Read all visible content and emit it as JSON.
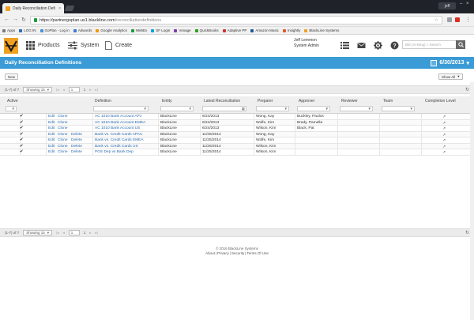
{
  "browser": {
    "tab_title": "Daily Reconciliation Defi",
    "tab_close": "×",
    "profile": "jeff",
    "url_host": "https://partnergoplan.us1.blackline.com",
    "url_path": "/reconciliationdefinitions",
    "bookmarks": [
      {
        "label": "Apps",
        "color": "#7a7a7a"
      },
      {
        "label": "LOG IN",
        "color": "#2b6cb0"
      },
      {
        "label": "GoPlan - Log in",
        "color": "#4a90d9"
      },
      {
        "label": "Adwords",
        "color": "#3a7bd5"
      },
      {
        "label": "Google Analytics",
        "color": "#f29900"
      },
      {
        "label": "WebEx",
        "color": "#1a9d3a"
      },
      {
        "label": "SF Login",
        "color": "#00a1e0"
      },
      {
        "label": "Vonage",
        "color": "#7b3ea8"
      },
      {
        "label": "QuickBooks",
        "color": "#2ca01c"
      },
      {
        "label": "Adaptive PP",
        "color": "#cc3333"
      },
      {
        "label": "Amazon Music",
        "color": "#1a5a9a"
      },
      {
        "label": "Insightly",
        "color": "#e25b26"
      },
      {
        "label": "BlackLine Systems",
        "color": "#f0a020"
      }
    ]
  },
  "app": {
    "nav": {
      "products": "Products",
      "system": "System",
      "create": "Create"
    },
    "user": {
      "name": "Jeff Lemmon",
      "role": "System Admin"
    },
    "search_placeholder": "Bld (AI-Bing) > Search"
  },
  "page": {
    "title": "Daily Reconciliation Definitions",
    "date": "6/30/2013",
    "new_button": "New",
    "show_all": "Show All"
  },
  "pager": {
    "range": "(1-7) of 7",
    "showing": "Showing 15",
    "page": "1",
    "of": "1"
  },
  "columns": {
    "active": "Active",
    "definition": "Definition",
    "entity": "Entity",
    "latest": "Latest Reconciliation",
    "preparer": "Preparer",
    "approver": "Approver",
    "reviewer": "Reviewer",
    "team": "Team",
    "completion": "Completion Level"
  },
  "rows": [
    {
      "actions": [
        "Edit",
        "Clone"
      ],
      "definition": "AC 1010 Bank Account APJ",
      "entity": "BlackLine",
      "latest": "6/24/2013",
      "preparer": "Wong, Kay",
      "approver": "Buckley, Paulos",
      "level": "↗"
    },
    {
      "actions": [
        "Edit",
        "Clone"
      ],
      "definition": "AC 1010 Bank Account EMEA",
      "entity": "BlackLine",
      "latest": "6/24/2013",
      "preparer": "Wolfe, Kim",
      "approver": "Brady, Pamella",
      "level": "↗"
    },
    {
      "actions": [
        "Edit",
        "Clone"
      ],
      "definition": "AC 1010 Bank Account US",
      "entity": "BlackLine",
      "latest": "6/24/2013",
      "preparer": "Wilson, Kim",
      "approver": "Black, Pat",
      "level": "↗"
    },
    {
      "actions": [
        "Edit",
        "Clone",
        "Delete"
      ],
      "definition": "Bank vs. Credit Cards APAC",
      "entity": "BlackLine",
      "latest": "11/25/2014",
      "preparer": "Wong, Kay",
      "approver": "",
      "level": "↗"
    },
    {
      "actions": [
        "Edit",
        "Clone",
        "Delete"
      ],
      "definition": "Bank vs. Credit Cards EMEA",
      "entity": "BlackLine",
      "latest": "11/25/2014",
      "preparer": "Wolfe, Kim",
      "approver": "",
      "level": "↗"
    },
    {
      "actions": [
        "Edit",
        "Clone",
        "Delete"
      ],
      "definition": "Bank vs. Credit Cards US",
      "entity": "BlackLine",
      "latest": "11/25/2014",
      "preparer": "Wilson, Kim",
      "approver": "",
      "level": "↗"
    },
    {
      "actions": [
        "Edit",
        "Clone",
        "Delete"
      ],
      "definition": "POS Dep vs Bank Dep",
      "entity": "BlackLine",
      "latest": "11/25/2014",
      "preparer": "Wilson, Kim",
      "approver": "",
      "level": "↗"
    }
  ],
  "footer": {
    "copyright": "© 2016 BlackLine Systems",
    "links": [
      "About",
      "Privacy",
      "Security",
      "Terms Of Use"
    ],
    "separator": "|"
  },
  "colors": {
    "accent": "#3a9bd6",
    "link": "#2b6cb0",
    "logo": "#f0a020"
  }
}
